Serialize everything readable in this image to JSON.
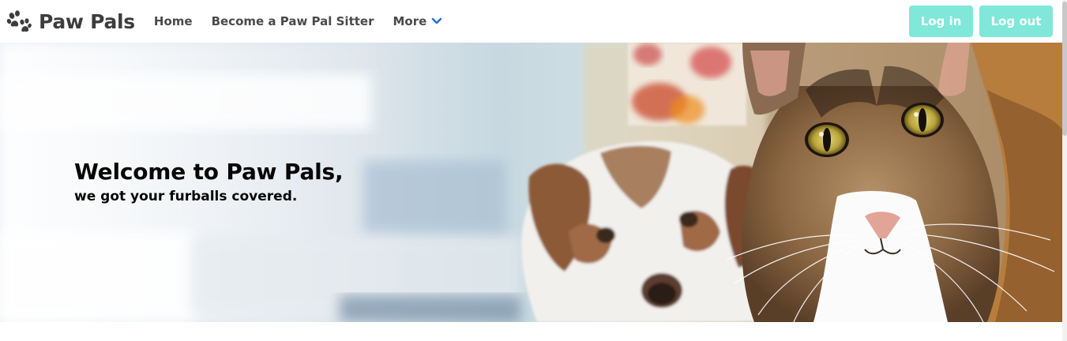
{
  "header": {
    "brand": {
      "name": "Paw Pals",
      "icon": "paw-print-icon"
    },
    "nav": [
      {
        "label": "Home"
      },
      {
        "label": "Become a Paw Pal Sitter"
      },
      {
        "label": "More",
        "icon": "chevron-down-icon"
      }
    ],
    "buttons": {
      "login_label": "Log in",
      "logout_label": "Log out"
    }
  },
  "hero": {
    "title": "Welcome to Paw Pals,",
    "subtitle": "we got your furballs covered.",
    "image": "dog-and-cat-photo"
  },
  "colors": {
    "accent": "#7fe8d8",
    "chevron": "#2a72c8",
    "text_dark": "#3d3d3d",
    "text_black": "#050505"
  }
}
